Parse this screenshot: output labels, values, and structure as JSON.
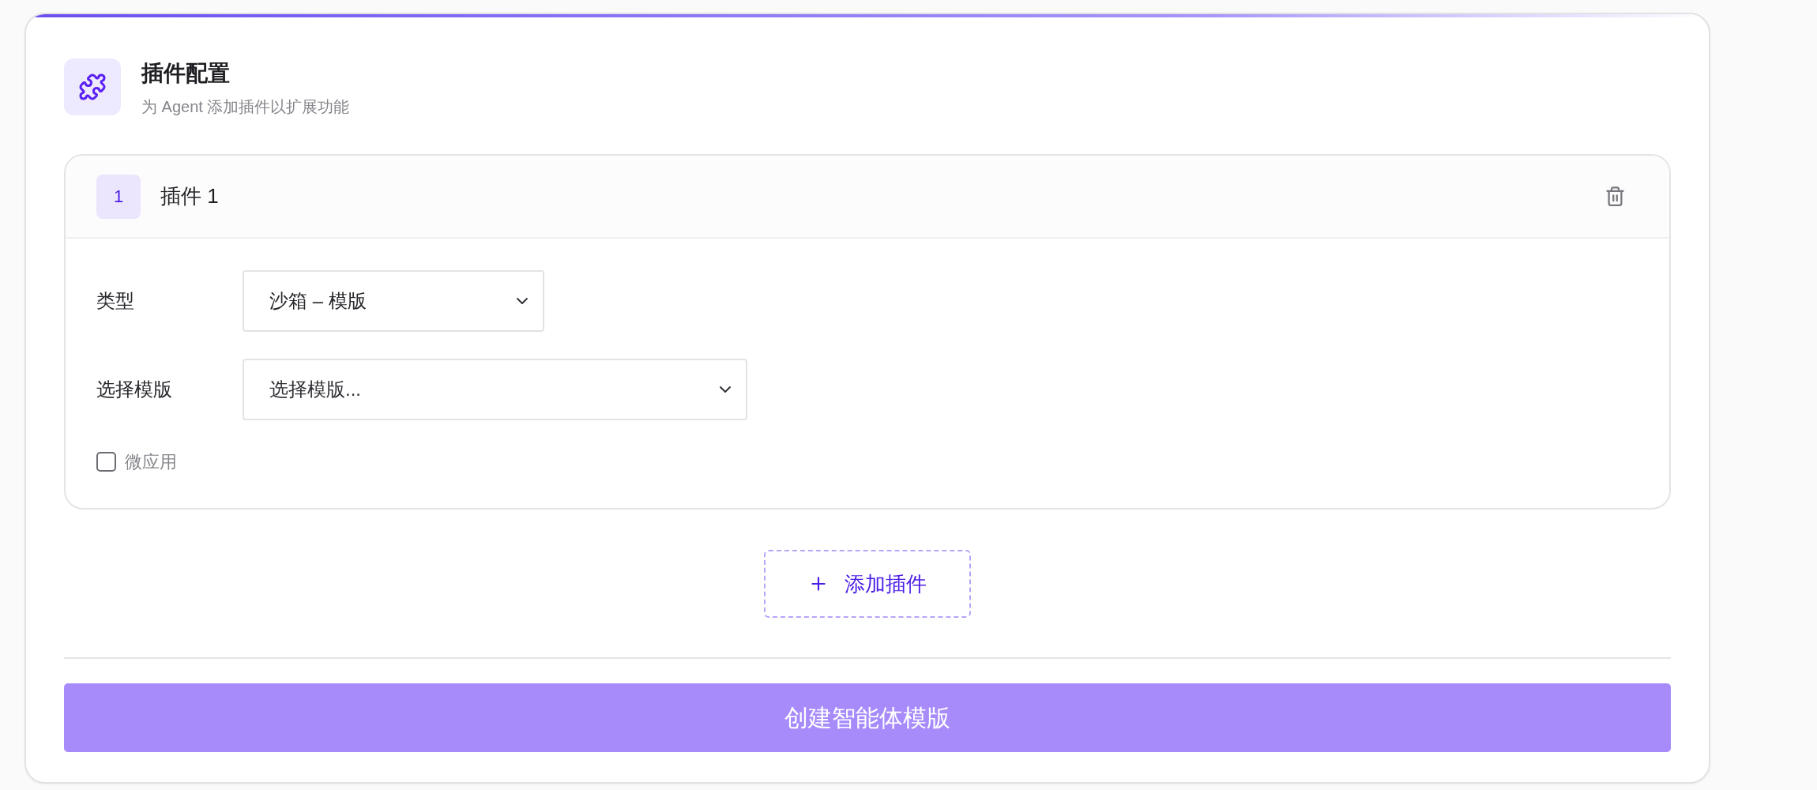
{
  "header": {
    "title": "插件配置",
    "subtitle": "为 Agent 添加插件以扩展功能"
  },
  "plugins": [
    {
      "index": "1",
      "title": "插件 1",
      "fields": [
        {
          "label": "类型",
          "kind": "select",
          "value": "沙箱 – 模版"
        },
        {
          "label": "选择模版",
          "kind": "select",
          "placeholder": "选择模版..."
        }
      ],
      "checkbox": {
        "label": "微应用",
        "checked": false
      }
    }
  ],
  "add_button": {
    "label": "添加插件"
  },
  "submit_button": {
    "label": "创建智能体模版",
    "disabled": true
  }
}
